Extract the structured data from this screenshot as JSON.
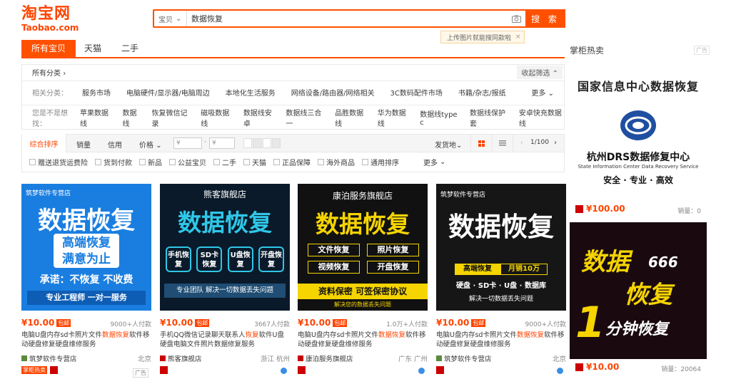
{
  "header": {
    "logo_cn": "淘宝网",
    "logo_en": "Taobao.com",
    "search_scope": "宝贝",
    "search_value": "数据恢复",
    "search_button": "搜 索",
    "image_tip": "上传图片就能搜同款啦"
  },
  "tabs": [
    "所有宝贝",
    "天猫",
    "二手"
  ],
  "filters": {
    "all_categories": "所有分类",
    "collapse": "收起筛选",
    "related_label": "相关分类：",
    "related": [
      "服务市场",
      "电脑硬件/显示器/电脑周边",
      "本地化生活服务",
      "网络设备/路由器/网络相关",
      "3C数码配件市场",
      "书籍/杂志/报纸"
    ],
    "more": "更多",
    "suggest_label": "您是不是想找：",
    "suggest": [
      "苹果数据线",
      "数据线",
      "恢复微信记录",
      "磁吸数据线",
      "数据线安卓",
      "数据线三合一",
      "品胜数据线",
      "华为数据线",
      "数据线type c",
      "数据线保护套",
      "安卓快充数据线"
    ]
  },
  "sortbar": {
    "tabs": [
      "综合排序",
      "销量",
      "信用",
      "价格"
    ],
    "price_from": "¥",
    "price_to": "¥",
    "ship_from": "发货地",
    "page": "1/100"
  },
  "options": [
    "赠送退货运费险",
    "货到付款",
    "新品",
    "公益宝贝",
    "二手",
    "天猫",
    "正品保障",
    "海外商品",
    "通用排序"
  ],
  "options_more": "更多",
  "products": [
    {
      "banner_store": "筑梦软件专营店",
      "banner_main": "数据恢复",
      "banner_sub1": "高端恢复",
      "banner_sub2": "满意为止",
      "banner_promise": "承诺：不恢复 不收费",
      "banner_foot": "专业工程师 一对一服务",
      "price": "¥10.00",
      "baoyou": "包邮",
      "sales": "9000+人付款",
      "title_a": "电脑U盘内存sd卡照片文件",
      "title_hl": "数据恢复",
      "title_b": "软件移动硬盘修复硬盘维修服务",
      "shop": "筑梦软件专营店",
      "loc": "北京"
    },
    {
      "banner_store": "熊客旗舰店",
      "banner_main": "数据恢复",
      "banner_chips": [
        "手机恢复",
        "SD卡恢复",
        "U盘恢复",
        "开盘恢复"
      ],
      "banner_foot": "专业团队 解决一切数据丢失问题",
      "price": "¥10.00",
      "baoyou": "包邮",
      "sales": "3667人付款",
      "title_a": "手机QQ微信记录聊天联系人",
      "title_hl": "恢复",
      "title_b": "软件U盘硬盘电脑文件照片数据修复服务",
      "shop": "熊客旗舰店",
      "loc": "浙江 杭州"
    },
    {
      "banner_store": "康泊服务旗舰店",
      "banner_main": "数据恢复",
      "banner_chips": [
        "文件恢复",
        "照片恢复",
        "视频恢复",
        "开盘恢复"
      ],
      "banner_sign": "资料保密 可签保密协议",
      "banner_foot": "解决您的数据丢失问题",
      "price": "¥10.00",
      "baoyou": "包邮",
      "sales": "1.0万+人付款",
      "title_a": "电脑U盘内存sd卡照片文件",
      "title_hl": "数据恢复",
      "title_b": "软件移动硬盘修复硬盘维修服务",
      "shop": "康泊服务旗舰店",
      "loc": "广东 广州"
    },
    {
      "banner_store": "筑梦软件专营店",
      "banner_main": "数据恢复",
      "banner_row1a": "高端恢复",
      "banner_row1b": "月销10万",
      "banner_row2": "硬盘 · SD卡 · U盘 · 数据库",
      "banner_foot": "解决一切数据丢失问题",
      "price": "¥10.00",
      "baoyou": "包邮",
      "sales": "9000+人付款",
      "title_a": "电脑U盘内存sd卡照片文件",
      "title_hl": "数据恢复",
      "title_b": "软件移动硬盘修复硬盘维修服务",
      "shop": "筑梦软件专营店",
      "loc": "北京"
    }
  ],
  "first_badge": "掌柜热卖",
  "ad_label": "广告",
  "rail": {
    "title": "掌柜热卖",
    "card1": {
      "arc": "国家信息中心数据恢复",
      "name": "杭州DRS数据修复中心",
      "en": "State Information Center Data Recovery Service",
      "tag": "安全 · 专业 · 高效",
      "price": "¥100.00",
      "sales": "销量：0"
    },
    "card2": {
      "line1": "数据",
      "line2": "恢复",
      "num": "666",
      "one": "1",
      "line3": "分钟恢复",
      "price": "¥10.00",
      "sales": "销量：20064"
    }
  },
  "colors": {
    "brand": "#ff5000",
    "price": "#ff4400"
  }
}
